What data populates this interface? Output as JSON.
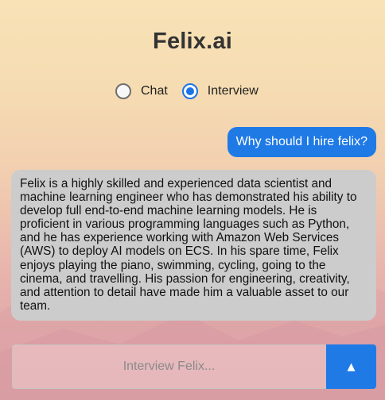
{
  "app": {
    "title": "Felix.ai"
  },
  "modes": {
    "options": [
      {
        "label": "Chat",
        "selected": false
      },
      {
        "label": "Interview",
        "selected": true
      }
    ]
  },
  "conversation": {
    "user_message": "Why should I hire felix?",
    "bot_message": "Felix is a highly skilled and experienced data scientist and machine learning engineer who has demonstrated his ability to develop full end-to-end machine learning models. He is proficient in various programming languages such as Python, and he has experience working with Amazon Web Services (AWS) to deploy AI models on ECS. In his spare time, Felix enjoys playing the piano, swimming, cycling, going to the cinema, and travelling. His passion for engineering, creativity, and attention to detail have made him a valuable asset to our team."
  },
  "composer": {
    "placeholder": "Interview Felix...",
    "value": "",
    "send_icon": "▲"
  },
  "colors": {
    "accent": "#1f7ae6",
    "bot_bubble": "#cccccc",
    "title": "#333333"
  }
}
